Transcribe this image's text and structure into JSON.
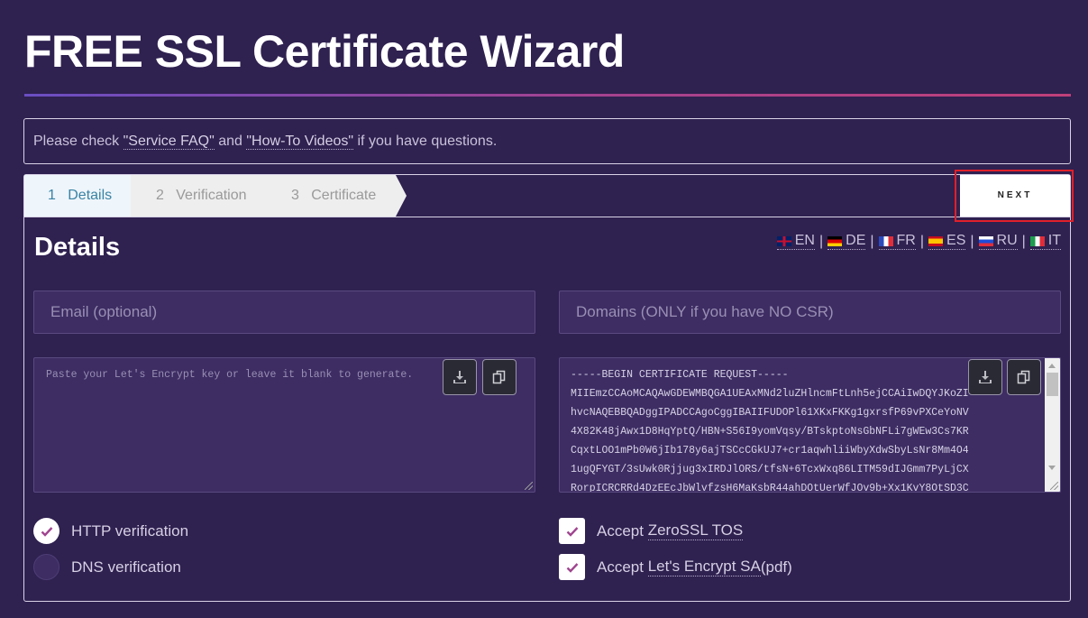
{
  "page": {
    "title": "FREE SSL Certificate Wizard"
  },
  "notice": {
    "prefix": "Please check ",
    "faq_link": "\"Service FAQ\"",
    "middle": " and ",
    "videos_link": "\"How-To Videos\"",
    "suffix": " if you have questions."
  },
  "steps": [
    {
      "number": "1",
      "label": "Details",
      "active": true
    },
    {
      "number": "2",
      "label": "Verification",
      "active": false
    },
    {
      "number": "3",
      "label": "Certificate",
      "active": false
    }
  ],
  "next_button": {
    "label": "NEXT"
  },
  "details": {
    "title": "Details"
  },
  "languages": [
    {
      "code": "EN",
      "flag": "uk-flag-icon"
    },
    {
      "code": "DE",
      "flag": "germany-flag-icon"
    },
    {
      "code": "FR",
      "flag": "france-flag-icon"
    },
    {
      "code": "ES",
      "flag": "spain-flag-icon"
    },
    {
      "code": "RU",
      "flag": "russia-flag-icon"
    },
    {
      "code": "IT",
      "flag": "italy-flag-icon"
    }
  ],
  "language_separator": "|",
  "form": {
    "email_placeholder": "Email (optional)",
    "domains_placeholder": "Domains (ONLY if you have NO CSR)",
    "key_placeholder": "Paste your Let's Encrypt key or leave it blank to generate.",
    "csr_lines": [
      "-----BEGIN CERTIFICATE REQUEST-----",
      "MIIEmzCCAoMCAQAwGDEWMBQGA1UEAxMNd2luZHlncmFtLnh5ejCCAiIwDQYJKoZI",
      "hvcNAQEBBQADggIPADCCAgoCggIBAIIFUDOPl61XKxFKKg1gxrsfP69vPXCeYoNV",
      "4X82K48jAwx1D8HqYptQ/HBN+S56I9yomVqsy/BTskptoNsGbNFLi7gWEw3Cs7KR",
      "CqxtLOO1mPb0W6jIb178y6ajTSCcCGkUJ7+cr1aqwhliiWbyXdwSbyLsNr8Mm4O4",
      "1ugQFYGT/3sUwk0Rjjug3xIRDJlORS/tfsN+6TcxWxq86LITM59dIJGmm7PyLjCX",
      "RorpICRCRRd4DzEEcJbWlvfzsH6MaKsbR44ahDOtUerWfJOv9b+Xx1KvY8OtSD3C"
    ]
  },
  "options": {
    "http_verification": {
      "label": "HTTP verification",
      "selected": true
    },
    "dns_verification": {
      "label": "DNS verification",
      "selected": false
    },
    "accept_zerossl_prefix": "Accept ",
    "accept_zerossl_link": "ZeroSSL TOS",
    "accept_le_prefix": "Accept ",
    "accept_le_link": "Let's Encrypt SA",
    "accept_le_suffix": " (pdf)"
  },
  "colors": {
    "background": "#2f2150",
    "accent_check": "#a0458f",
    "highlight_border": "#e0202a"
  }
}
